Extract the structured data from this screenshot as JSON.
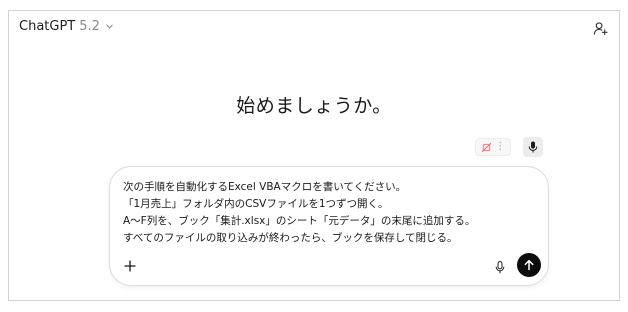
{
  "header": {
    "model_name": "ChatGPT",
    "model_version": "5.2",
    "model_chevron_icon": "chevron-down-icon",
    "user_icon": "add-person-icon"
  },
  "main": {
    "headline": "始めましょうか。"
  },
  "extension_bar": {
    "icons": [
      "crossed-out-icon",
      "more-vertical-icon",
      "microphone-icon"
    ]
  },
  "composer": {
    "lines": [
      "次の手順を自動化するExcel VBAマクロを書いてください。",
      "「1月売上」フォルダ内のCSVファイルを1つずつ開く。",
      "A〜F列を、ブック「集計.xlsx」のシート「元データ」の末尾に追加する。",
      "すべてのファイルの取り込みが終わったら、ブックを保存して閉じる。"
    ],
    "plus_icon": "plus-icon",
    "mic_icon": "microphone-icon",
    "send_icon": "arrow-up-icon"
  },
  "colors": {
    "send_button_bg": "#0d0d0d",
    "border": "#dcdcdc",
    "muted_text": "#8a8a8a"
  }
}
